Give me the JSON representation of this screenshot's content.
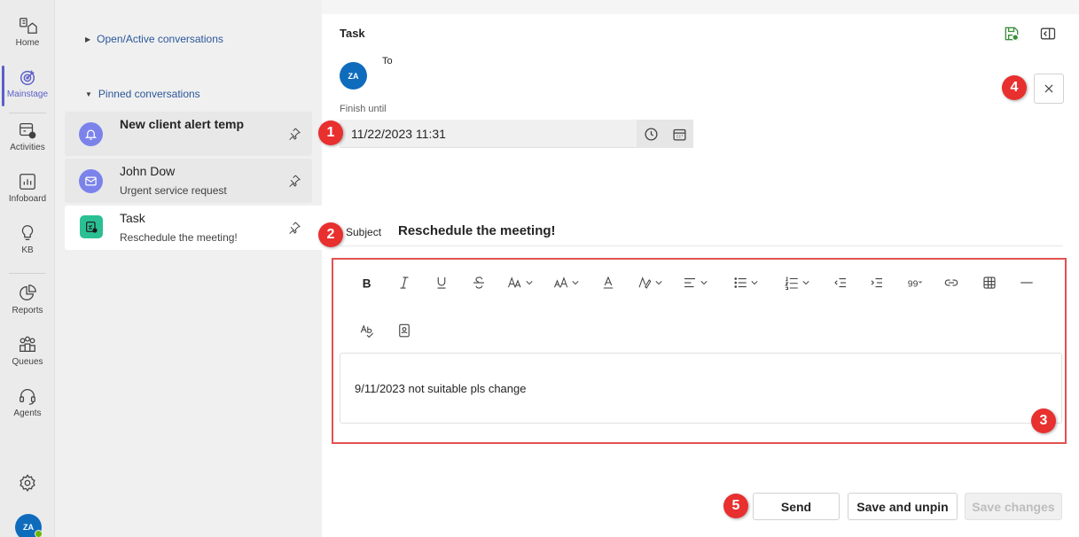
{
  "rail": {
    "items": [
      {
        "label": "Home",
        "icon": "home-icon"
      },
      {
        "label": "Mainstage",
        "icon": "target-icon",
        "active": true
      },
      {
        "label": "Activities",
        "icon": "activities-icon"
      },
      {
        "label": "Infoboard",
        "icon": "infoboard-icon"
      },
      {
        "label": "KB",
        "icon": "lightbulb-icon"
      },
      {
        "label": "Reports",
        "icon": "pie-chart-icon"
      },
      {
        "label": "Queues",
        "icon": "queues-icon"
      },
      {
        "label": "Agents",
        "icon": "headset-icon"
      }
    ],
    "avatar_initials": "ZA"
  },
  "conversations": {
    "open_section": "Open/Active conversations",
    "pinned_section": "Pinned conversations",
    "items": [
      {
        "title": "New client alert temp",
        "subtitle": "",
        "icon": "bell-icon",
        "icon_color": "#7b83eb"
      },
      {
        "title": "John Dow",
        "subtitle": "Urgent service request",
        "icon": "mail-icon",
        "icon_color": "#7b83eb"
      },
      {
        "title": "Task",
        "subtitle": "Reschedule the meeting!",
        "icon": "task-icon",
        "icon_color": "#2bbf94"
      }
    ]
  },
  "task": {
    "title": "Task",
    "to_label": "To",
    "to_avatar": "ZA",
    "finish_label": "Finish until",
    "finish_value": "11/22/2023 11:31",
    "subject_label": "Subject",
    "subject_value": "Reschedule the meeting!",
    "body_text": "9/11/2023 not suitable pls change"
  },
  "toolbar": {
    "buttons": [
      "bold",
      "italic",
      "underline",
      "strikethrough",
      "font",
      "font-size",
      "font-color",
      "highlight",
      "align",
      "bullets",
      "numbering",
      "decrease-indent",
      "increase-indent",
      "quote",
      "link",
      "table",
      "horizontal-rule",
      "spell-check",
      "contact-card"
    ]
  },
  "actions": {
    "send": "Send",
    "save_unpin": "Save and unpin",
    "save_changes": "Save changes"
  },
  "callouts": [
    "1",
    "2",
    "3",
    "4",
    "5"
  ],
  "colors": {
    "accent": "#5b5fc7",
    "callout": "#e8302f",
    "link": "#2b579a"
  }
}
